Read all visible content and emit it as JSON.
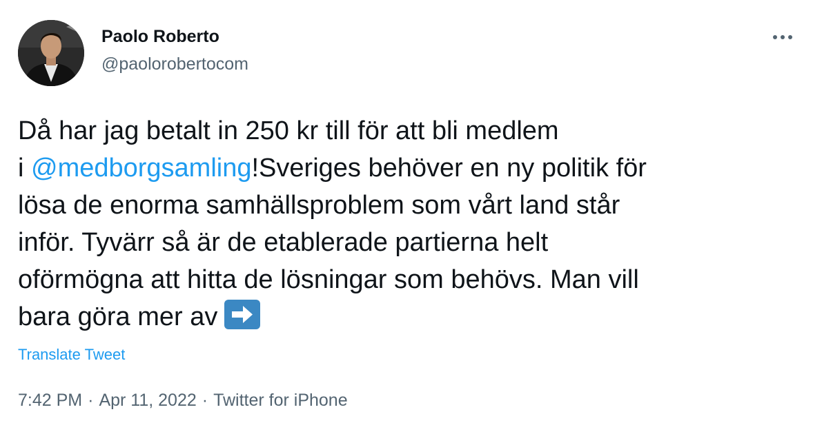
{
  "author": {
    "name": "Paolo Roberto",
    "handle": "@paolorobertocom",
    "avatar_icon": "profile-photo"
  },
  "menu": {
    "icon": "more-dots-icon"
  },
  "tweet": {
    "lines": [
      "Då har jag betalt in 250 kr till för att bli medlem",
      "lösa de enorma samhällsproblem som vårt land står",
      "inför. Tyvärr så är de etablerade partierna helt",
      "oförmögna att hitta de lösningar som behövs. Man vill",
      "bara göra mer av"
    ],
    "line2_prefix": "i ",
    "mention": "@medborgsamling",
    "line2_suffix": "!Sveriges behöver en ny politik för",
    "emoji": "right-arrow-emoji"
  },
  "translate_label": "Translate Tweet",
  "meta": {
    "time": "7:42 PM",
    "date": "Apr 11, 2022",
    "separator": "·",
    "source": "Twitter for iPhone"
  },
  "colors": {
    "link": "#1d9bf0",
    "text": "#0f1419",
    "secondary": "#536471",
    "emoji_bg": "#3b88c3"
  }
}
